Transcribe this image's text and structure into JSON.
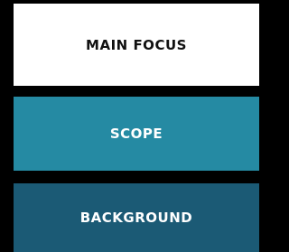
{
  "layers": [
    {
      "label": "MAIN FOCUS"
    },
    {
      "label": "SCOPE"
    },
    {
      "label": "BACKGROUND"
    }
  ],
  "colors": {
    "canvas": "#000000",
    "main_focus_fill": "#ffffff",
    "main_focus_text": "#111111",
    "scope_fill": "#258aa3",
    "background_fill": "#1b5a75",
    "light_text": "#ffffff"
  }
}
